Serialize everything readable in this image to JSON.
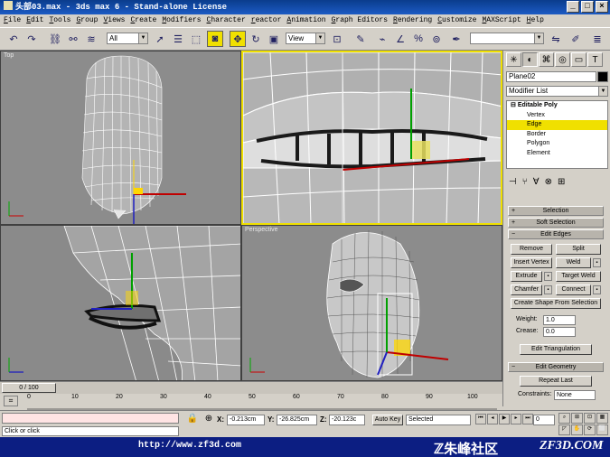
{
  "window": {
    "title": "头部03.max - 3ds max 6 - Stand-alone License",
    "minimize": "_",
    "maximize": "□",
    "close": "×"
  },
  "menu": [
    "File",
    "Edit",
    "Tools",
    "Group",
    "Views",
    "Create",
    "Modifiers",
    "Character",
    "reactor",
    "Animation",
    "Graph Editors",
    "Rendering",
    "Customize",
    "MAXScript",
    "Help"
  ],
  "toolbar": {
    "selection_filter": "All",
    "ref_coord": "View",
    "named_sel": ""
  },
  "viewports": {
    "top": "Top",
    "front": "",
    "left": "",
    "perspective": "Perspective"
  },
  "command_panel": {
    "object_name": "Plane02",
    "modifier_list": "Modifier List",
    "stack": {
      "head": "Editable Poly",
      "items": [
        "Vertex",
        "Edge",
        "Border",
        "Polygon",
        "Element"
      ],
      "selected": "Edge"
    },
    "rollouts": {
      "selection": "Selection",
      "soft_selection": "Soft Selection",
      "edit_edges": "Edit Edges",
      "edit_geometry": "Edit Geometry"
    },
    "buttons": {
      "remove": "Remove",
      "split": "Split",
      "insert_vertex": "Insert Vertex",
      "weld": "Weld",
      "extrude": "Extrude",
      "target_weld": "Target Weld",
      "chamfer": "Chamfer",
      "connect": "Connect",
      "create_shape": "Create Shape From Selection",
      "edit_triangulation": "Edit Triangulation",
      "repeat_last": "Repeat Last"
    },
    "weight_label": "Weight:",
    "weight_value": "1.0",
    "crease_label": "Crease:",
    "crease_value": "0.0",
    "constraints_label": "Constraints:",
    "constraints_value": "None"
  },
  "timeline": {
    "slider": "0 / 100",
    "ticks": [
      "0",
      "10",
      "20",
      "30",
      "40",
      "50",
      "60",
      "70",
      "80",
      "90",
      "100"
    ]
  },
  "status": {
    "x_label": "X:",
    "x": "-0.213cm",
    "y_label": "Y:",
    "y": "-26.825cm",
    "z_label": "Z:",
    "z": "-20.123c",
    "auto_key": "Auto Key",
    "key_filter": "Selected",
    "frame": "0",
    "prompt": "Click or click"
  },
  "footer": {
    "url": "http://www.zf3d.com",
    "cn": "ℤ朱峰社区",
    "brand": "ZF3D.COM"
  },
  "colors": {
    "selection": "#f0e000",
    "viewport_bg": "#8c8c8c",
    "footer_bg": "#0c1e82"
  }
}
